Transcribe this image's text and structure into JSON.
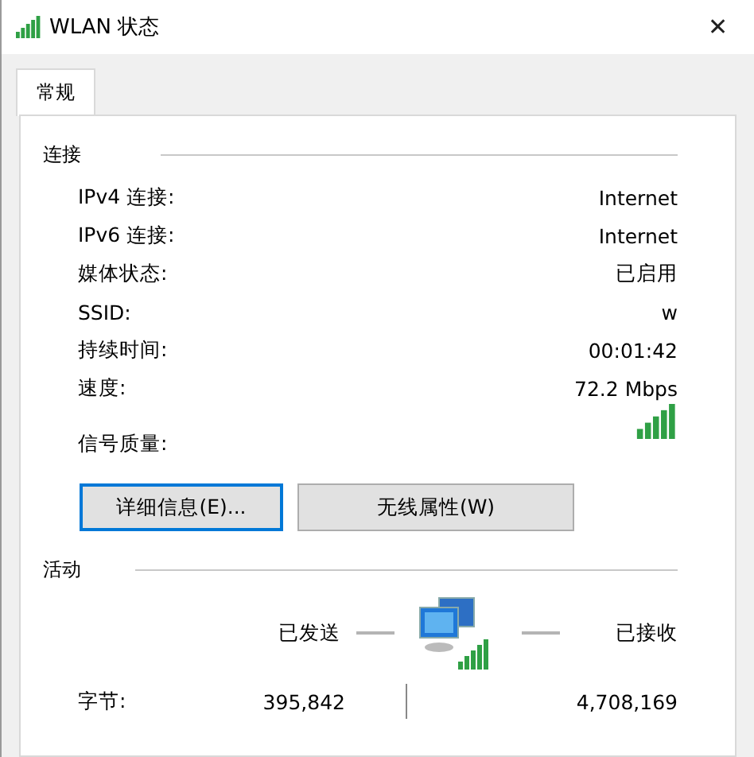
{
  "window": {
    "title": "WLAN 状态",
    "close": "✕"
  },
  "tabs": [
    {
      "label": "常规",
      "selected": true
    }
  ],
  "connection": {
    "heading": "连接",
    "rows": [
      {
        "kind": "text",
        "label": "IPv4 连接:",
        "value": "Internet"
      },
      {
        "kind": "text",
        "label": "IPv6 连接:",
        "value": "Internet"
      },
      {
        "kind": "text",
        "label": "媒体状态:",
        "value": "已启用"
      },
      {
        "kind": "text",
        "label": "SSID:",
        "value": "w"
      },
      {
        "kind": "text",
        "label": "持续时间:",
        "value": "00:01:42"
      },
      {
        "kind": "text",
        "label": "速度:",
        "value": "72.2 Mbps"
      },
      {
        "kind": "signal",
        "label": "信号质量:"
      }
    ]
  },
  "buttons": [
    {
      "label": "详细信息(E)...",
      "focused": true
    },
    {
      "label": "无线属性(W)",
      "focused": false
    }
  ],
  "activity": {
    "heading": "活动",
    "sent_label": "已发送",
    "received_label": "已接收",
    "bytes_label": "字节:",
    "bytes_sent": "395,842",
    "bytes_received": "4,708,169"
  }
}
